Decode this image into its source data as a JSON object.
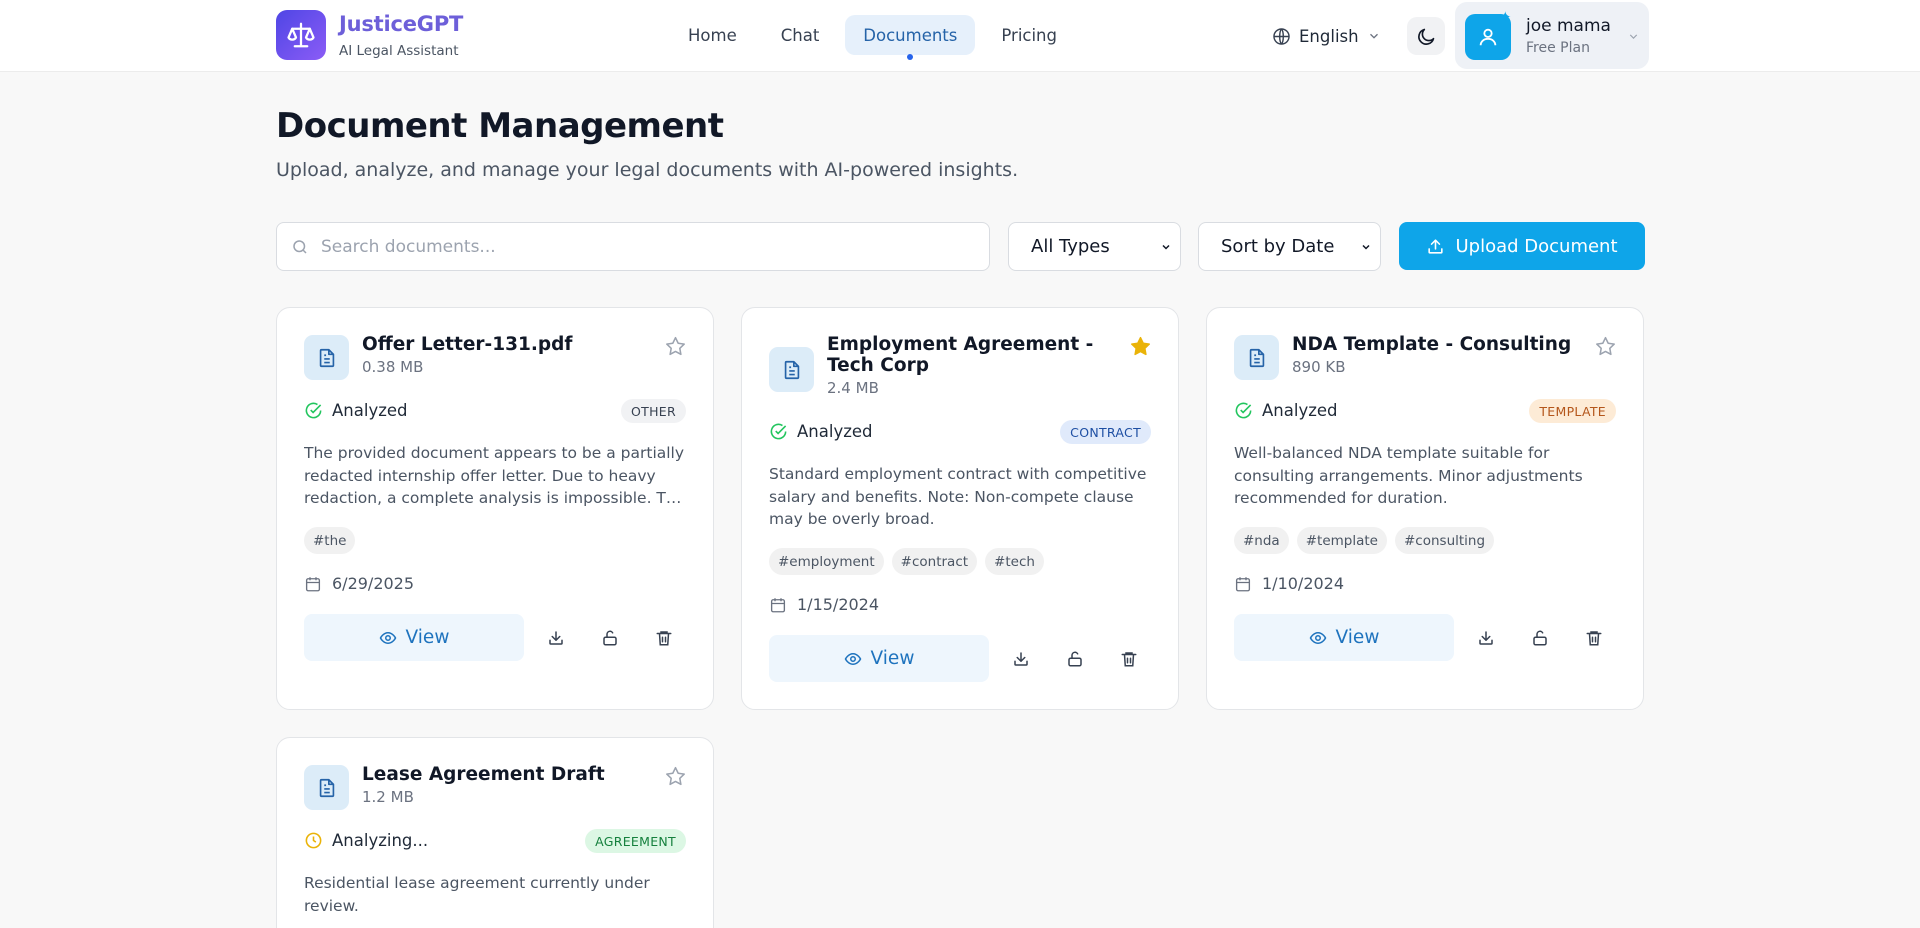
{
  "brand": {
    "name": "JusticeGPT",
    "subtitle": "AI Legal Assistant",
    "logo_icon": "scales-icon"
  },
  "nav": {
    "items": [
      "Home",
      "Chat",
      "Documents",
      "Pricing"
    ],
    "active": "Documents"
  },
  "language": {
    "label": "English",
    "icon": "globe-icon"
  },
  "theme_toggle": {
    "icon": "moon-icon"
  },
  "user": {
    "name": "joe mama",
    "plan": "Free Plan"
  },
  "page": {
    "title": "Document Management",
    "subtitle": "Upload, analyze, and manage your legal documents with AI-powered insights."
  },
  "toolbar": {
    "search_placeholder": "Search documents...",
    "search_value": "",
    "type_filter": "All Types",
    "sort": "Sort by Date",
    "upload_label": "Upload Document"
  },
  "colors": {
    "accent": "#0ea5e9",
    "star_active": "#eab308",
    "analyzed": "#22c55e",
    "analyzing": "#eab308"
  },
  "documents": [
    {
      "title": "Offer Letter-131.pdf",
      "size": "0.38 MB",
      "starred": false,
      "status": "Analyzed",
      "type": "OTHER",
      "description": "The provided document appears to be a partially redacted internship offer letter. Due to heavy redaction, a complete analysis is impossible. The document lacks crucial information.",
      "tags": [
        "#the"
      ],
      "date": "6/29/2025",
      "view_label": "View"
    },
    {
      "title": "Employment Agreement - Tech Corp",
      "size": "2.4 MB",
      "starred": true,
      "status": "Analyzed",
      "type": "CONTRACT",
      "description": "Standard employment contract with competitive salary and benefits. Note: Non-compete clause may be overly broad.",
      "tags": [
        "#employment",
        "#contract",
        "#tech"
      ],
      "date": "1/15/2024",
      "view_label": "View"
    },
    {
      "title": "NDA Template - Consulting",
      "size": "890 KB",
      "starred": false,
      "status": "Analyzed",
      "type": "TEMPLATE",
      "description": "Well-balanced NDA template suitable for consulting arrangements. Minor adjustments recommended for duration.",
      "tags": [
        "#nda",
        "#template",
        "#consulting"
      ],
      "date": "1/10/2024",
      "view_label": "View"
    },
    {
      "title": "Lease Agreement Draft",
      "size": "1.2 MB",
      "starred": false,
      "status": "Analyzing...",
      "type": "AGREEMENT",
      "description": "Residential lease agreement currently under review."
    }
  ]
}
